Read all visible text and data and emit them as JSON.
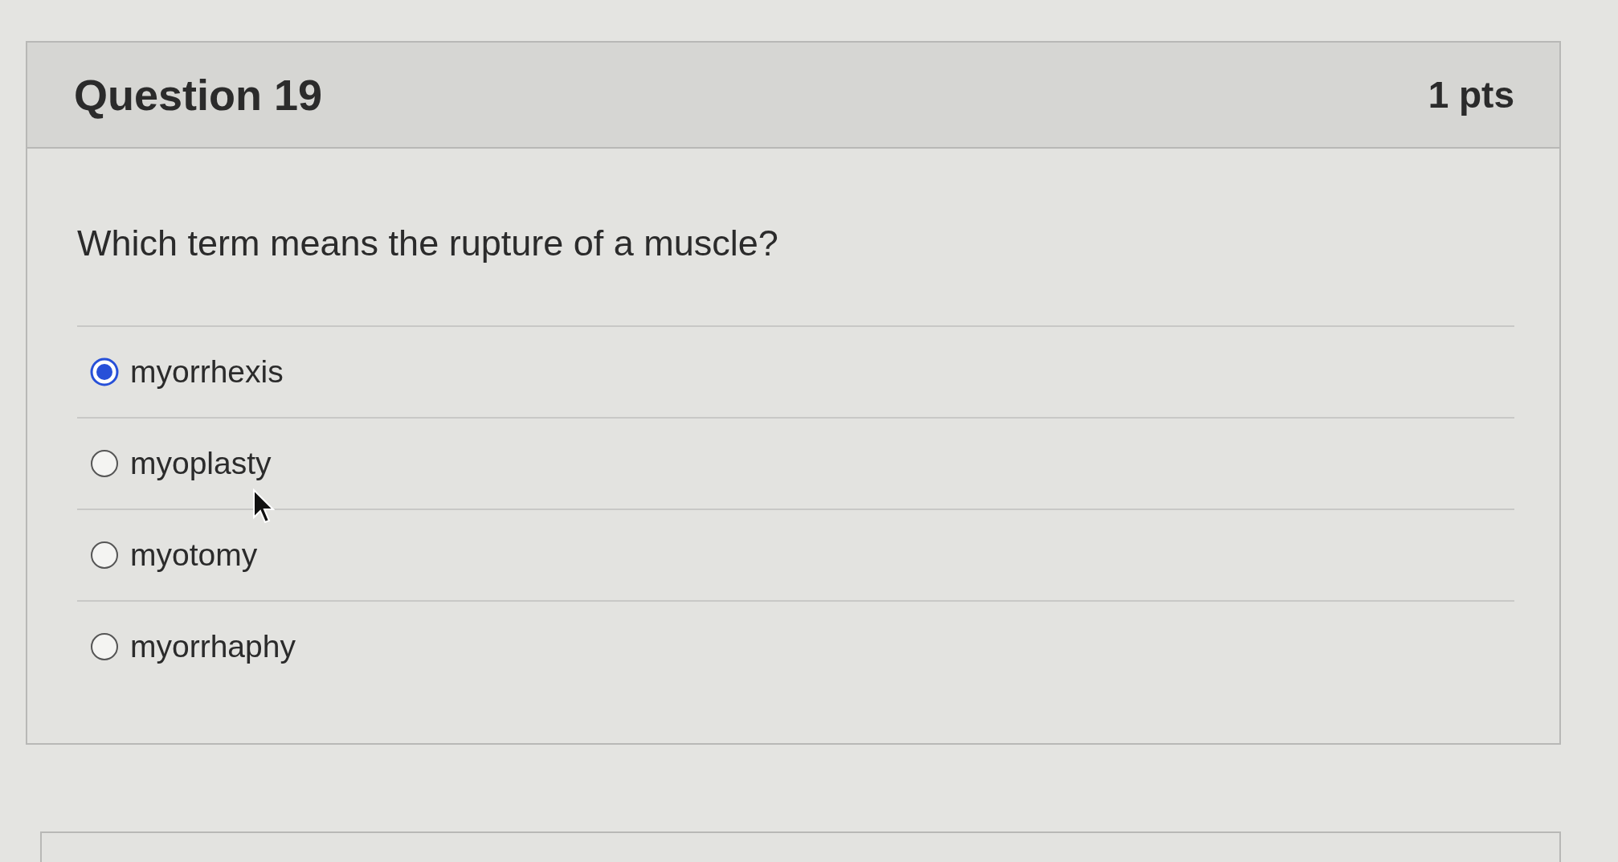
{
  "question": {
    "title": "Question 19",
    "points": "1 pts",
    "text": "Which term means the rupture of a muscle?",
    "answers": [
      {
        "label": "myorrhexis",
        "selected": true
      },
      {
        "label": "myoplasty",
        "selected": false
      },
      {
        "label": "myotomy",
        "selected": false
      },
      {
        "label": "myorrhaphy",
        "selected": false
      }
    ]
  }
}
